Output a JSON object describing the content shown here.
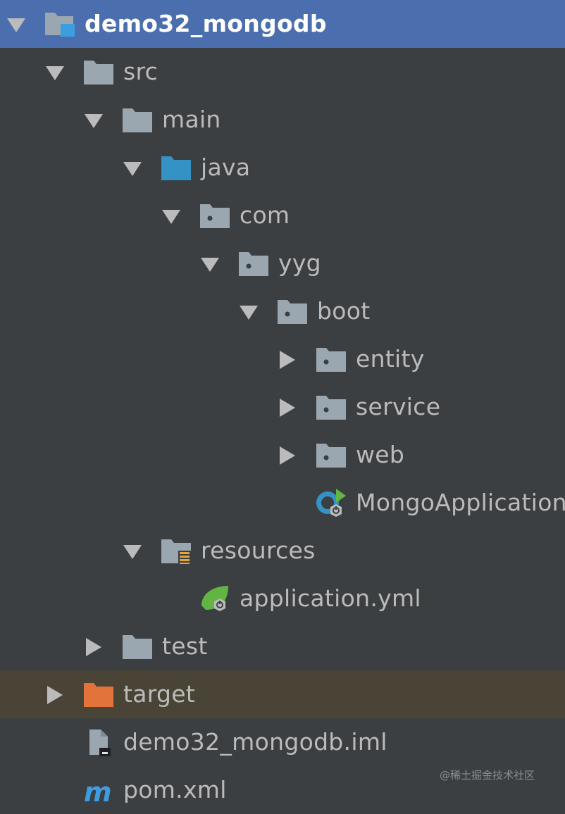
{
  "tree": [
    {
      "label": "demo32_mongodb",
      "depth": 0,
      "arrow": "expanded",
      "icon": "module-folder-icon",
      "state": "selected"
    },
    {
      "label": "src",
      "depth": 1,
      "arrow": "expanded",
      "icon": "folder-icon"
    },
    {
      "label": "main",
      "depth": 2,
      "arrow": "expanded",
      "icon": "folder-icon"
    },
    {
      "label": "java",
      "depth": 3,
      "arrow": "expanded",
      "icon": "source-root-folder-icon"
    },
    {
      "label": "com",
      "depth": 4,
      "arrow": "expanded",
      "icon": "package-icon"
    },
    {
      "label": "yyg",
      "depth": 5,
      "arrow": "expanded",
      "icon": "package-icon"
    },
    {
      "label": "boot",
      "depth": 6,
      "arrow": "expanded",
      "icon": "package-icon"
    },
    {
      "label": "entity",
      "depth": 7,
      "arrow": "collapsed",
      "icon": "package-icon"
    },
    {
      "label": "service",
      "depth": 7,
      "arrow": "collapsed",
      "icon": "package-icon"
    },
    {
      "label": "web",
      "depth": 7,
      "arrow": "collapsed",
      "icon": "package-icon"
    },
    {
      "label": "MongoApplication",
      "depth": 7,
      "arrow": "none",
      "icon": "spring-boot-class-icon"
    },
    {
      "label": "resources",
      "depth": 3,
      "arrow": "expanded",
      "icon": "resources-folder-icon"
    },
    {
      "label": "application.yml",
      "depth": 4,
      "arrow": "none",
      "icon": "spring-config-icon"
    },
    {
      "label": "test",
      "depth": 2,
      "arrow": "collapsed",
      "icon": "folder-icon"
    },
    {
      "label": "target",
      "depth": 1,
      "arrow": "collapsed",
      "icon": "excluded-folder-icon",
      "state": "excluded"
    },
    {
      "label": "demo32_mongodb.iml",
      "depth": 1,
      "arrow": "none",
      "icon": "iml-file-icon"
    },
    {
      "label": "pom.xml",
      "depth": 1,
      "arrow": "none",
      "icon": "maven-icon"
    }
  ],
  "watermark": "@稀土掘金技术社区",
  "colors": {
    "background": "#3c3f41",
    "selection": "#4b6eaf",
    "excluded_row": "#4a4437",
    "text": "#bbbbbb",
    "folder": "#9aa7b0",
    "source_root": "#3592c4",
    "excluded_folder": "#e2733b",
    "spring_green": "#62b543"
  }
}
